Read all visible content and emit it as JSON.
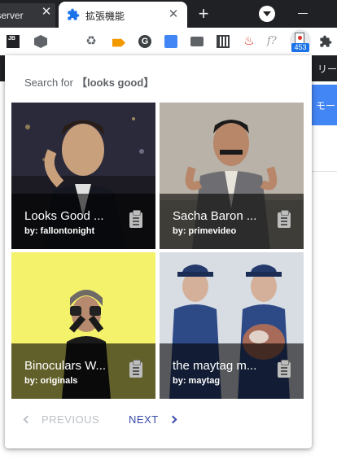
{
  "browser": {
    "tab_partial_title": "t-server",
    "tab_active_title": "拡張機能",
    "new_tab": "+",
    "toolbar_badge": "453",
    "reader_label": "リーデ",
    "page_button_label": "モー"
  },
  "popup": {
    "search_prefix": "Search for",
    "search_query": "【looks good】",
    "results": [
      {
        "title": "Looks Good ...",
        "by": "by: fallontonight"
      },
      {
        "title": "Sacha Baron ...",
        "by": "by: primevideo"
      },
      {
        "title": "Binoculars W...",
        "by": "by: originals"
      },
      {
        "title": "the maytag m...",
        "by": "by: maytag"
      }
    ],
    "previous_label": "PREVIOUS",
    "next_label": "NEXT"
  },
  "colors": {
    "accent": "#3949ab",
    "badge": "#1a73e8",
    "chrome_dark": "#202124",
    "yellow_scene": "#f4f16a"
  },
  "icons": [
    "extension-icon",
    "close-icon",
    "new-tab-icon",
    "download-icon",
    "clipboard-icon",
    "chevron-left-icon",
    "chevron-right-icon"
  ]
}
